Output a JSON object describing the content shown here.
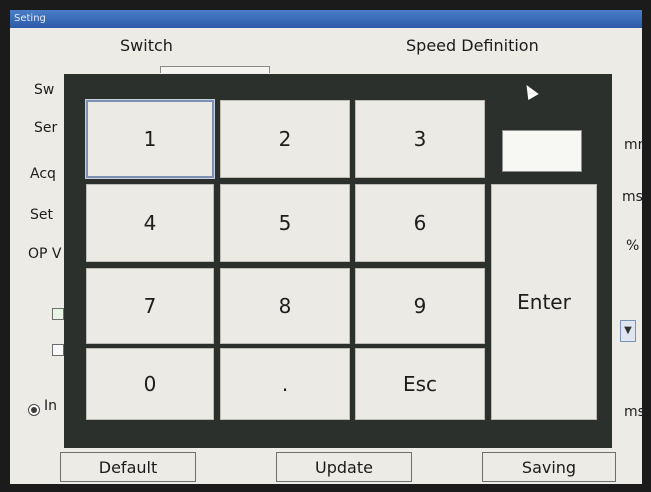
{
  "window": {
    "title": "Seting"
  },
  "tabs": [
    {
      "label": "Switch"
    },
    {
      "label": "Speed Definition"
    }
  ],
  "background_labels": {
    "row1": "Sw",
    "row2": "Ser",
    "row3": "Acq",
    "row4": "Set",
    "row5": "OP V",
    "radio_label": "In"
  },
  "units": {
    "u1": "mm",
    "u2": "ms",
    "u3": "%",
    "u4": "ms"
  },
  "keypad": {
    "display_value": "",
    "keys": {
      "k1": "1",
      "k2": "2",
      "k3": "3",
      "k4": "4",
      "k5": "5",
      "k6": "6",
      "k7": "7",
      "k8": "8",
      "k9": "9",
      "k0": "0",
      "kdot": ".",
      "kesc": "Esc",
      "kenter": "Enter"
    }
  },
  "bottom_buttons": {
    "default": "Default",
    "update": "Update",
    "saving": "Saving"
  },
  "colors": {
    "titlebar": "#2c5aa8",
    "keypad_frame": "#2b302c",
    "key_face": "#ebeae4",
    "window_bg": "#ecebe6"
  },
  "icons": {
    "cursor": "mouse-pointer-icon",
    "dropdown": "chevron-down-icon"
  }
}
